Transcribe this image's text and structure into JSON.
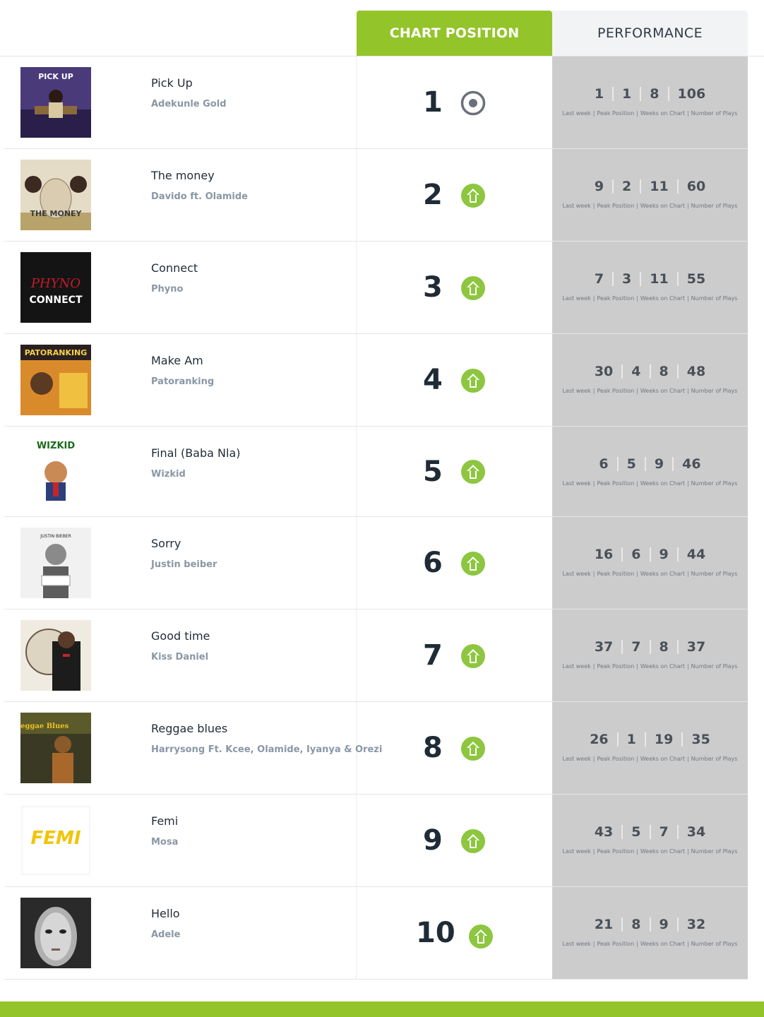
{
  "header": {
    "chart_position_label": "CHART POSITION",
    "performance_label": "PERFORMANCE"
  },
  "stat_labels": [
    "Last week",
    "Peak Position",
    "Weeks on Chart",
    "Number of Plays"
  ],
  "colors": {
    "accent": "#93c42a",
    "perf_bg": "#cccccc",
    "text_dark": "#1f2b36",
    "text_muted": "#8a97a5"
  },
  "rows": [
    {
      "title": "Pick Up",
      "artist": "Adekunle Gold",
      "position": "1",
      "movement": "same",
      "movement_icon": "target-icon",
      "stats": [
        "1",
        "1",
        "8",
        "106"
      ]
    },
    {
      "title": "The money",
      "artist": "Davido ft. Olamide",
      "position": "2",
      "movement": "up",
      "movement_icon": "arrow-up-icon",
      "stats": [
        "9",
        "2",
        "11",
        "60"
      ]
    },
    {
      "title": "Connect",
      "artist": "Phyno",
      "position": "3",
      "movement": "up",
      "movement_icon": "arrow-up-icon",
      "stats": [
        "7",
        "3",
        "11",
        "55"
      ]
    },
    {
      "title": "Make Am",
      "artist": "Patoranking",
      "position": "4",
      "movement": "up",
      "movement_icon": "arrow-up-icon",
      "stats": [
        "30",
        "4",
        "8",
        "48"
      ]
    },
    {
      "title": "Final (Baba Nla)",
      "artist": "Wizkid",
      "position": "5",
      "movement": "up",
      "movement_icon": "arrow-up-icon",
      "stats": [
        "6",
        "5",
        "9",
        "46"
      ]
    },
    {
      "title": "Sorry",
      "artist": "Justin beiber",
      "position": "6",
      "movement": "up",
      "movement_icon": "arrow-up-icon",
      "stats": [
        "16",
        "6",
        "9",
        "44"
      ]
    },
    {
      "title": "Good time",
      "artist": "Kiss Daniel",
      "position": "7",
      "movement": "up",
      "movement_icon": "arrow-up-icon",
      "stats": [
        "37",
        "7",
        "8",
        "37"
      ]
    },
    {
      "title": "Reggae blues",
      "artist": "Harrysong Ft. Kcee, Olamide, Iyanya & Orezi",
      "position": "8",
      "movement": "up",
      "movement_icon": "arrow-up-icon",
      "stats": [
        "26",
        "1",
        "19",
        "35"
      ]
    },
    {
      "title": "Femi",
      "artist": "Mosa",
      "position": "9",
      "movement": "up",
      "movement_icon": "arrow-up-icon",
      "stats": [
        "43",
        "5",
        "7",
        "34"
      ]
    },
    {
      "title": "Hello",
      "artist": "Adele",
      "position": "10",
      "movement": "up",
      "movement_icon": "arrow-up-icon",
      "stats": [
        "21",
        "8",
        "9",
        "32"
      ]
    }
  ],
  "album_art": [
    {
      "name": "album-art-pick-up",
      "text": "PICK UP"
    },
    {
      "name": "album-art-the-money",
      "text": "THE MONEY"
    },
    {
      "name": "album-art-connect",
      "text": "CONNECT"
    },
    {
      "name": "album-art-make-am",
      "text": "PATORANKING"
    },
    {
      "name": "album-art-final",
      "text": "WIZKID"
    },
    {
      "name": "album-art-sorry",
      "text": "JUSTIN BIEBER"
    },
    {
      "name": "album-art-good-time",
      "text": ""
    },
    {
      "name": "album-art-reggae-blues",
      "text": "Reggae Blues"
    },
    {
      "name": "album-art-femi",
      "text": "FEMI"
    },
    {
      "name": "album-art-hello",
      "text": ""
    }
  ]
}
